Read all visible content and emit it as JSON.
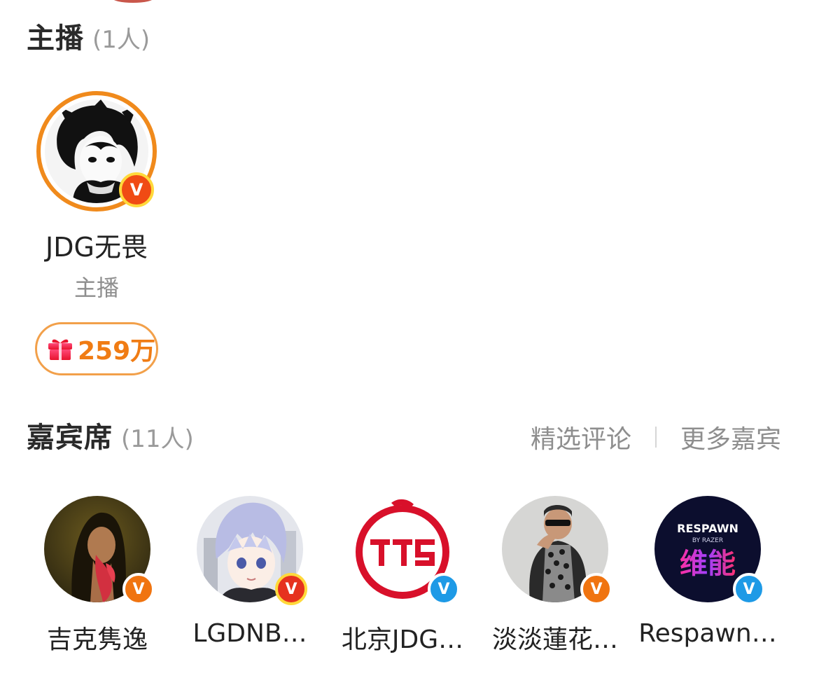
{
  "host_section": {
    "title": "主播",
    "count": "(1人)",
    "host": {
      "name": "JDG无畏",
      "role": "主播",
      "gift_value": "259万",
      "verified_icon": "v-badge-orange"
    }
  },
  "guest_section": {
    "title": "嘉宾席",
    "count": "(11人)",
    "actions": {
      "featured_comments": "精选评论",
      "more_guests": "更多嘉宾"
    },
    "guests": [
      {
        "name": "吉克隽逸",
        "badge": "orange"
      },
      {
        "name": "LGDNB…",
        "badge": "red"
      },
      {
        "name": "北京JDG…",
        "badge": "blue"
      },
      {
        "name": "淡淡蓮花…",
        "badge": "orange"
      },
      {
        "name": "Respawn…",
        "badge": "blue"
      }
    ]
  },
  "respawn_logo": {
    "brand": "RESPAWN",
    "sub": "BY RAZER",
    "cn": "维能"
  },
  "colors": {
    "accent_orange": "#f07c14",
    "verified_blue": "#1e9ae6",
    "verified_orange": "#f07410"
  }
}
